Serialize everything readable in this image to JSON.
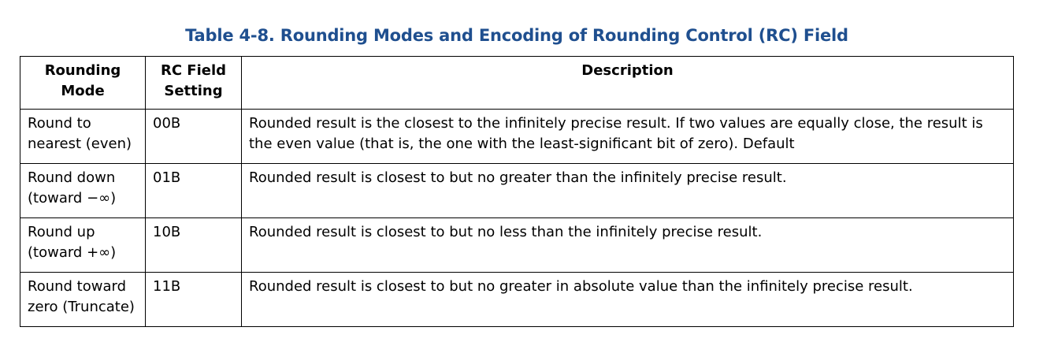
{
  "caption": "Table 4-8.  Rounding Modes and Encoding of Rounding Control (RC) Field",
  "colors": {
    "caption": "#1f4f8f",
    "border": "#000000",
    "text": "#000000"
  },
  "table": {
    "headers": {
      "mode": "Rounding Mode",
      "rc": "RC Field Setting",
      "description": "Description"
    },
    "rows": [
      {
        "mode": "Round to nearest (even)",
        "rc": "00B",
        "description": "Rounded result is the closest to the infinitely precise result. If two values are equally close, the result is the even value (that is, the one with the least-significant bit of zero). Default"
      },
      {
        "mode": "Round down (toward −∞)",
        "rc": "01B",
        "description": "Rounded result is closest to but no greater than the infinitely precise result."
      },
      {
        "mode": "Round up (toward +∞)",
        "rc": "10B",
        "description": "Rounded result is closest to but no less than the infinitely precise result."
      },
      {
        "mode": "Round toward zero (Truncate)",
        "rc": "11B",
        "description": "Rounded result is closest to but no greater in absolute value than the infinitely precise result."
      }
    ]
  }
}
